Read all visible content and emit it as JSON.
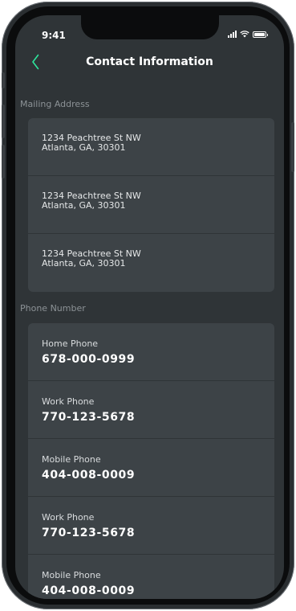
{
  "status_bar": {
    "time": "9:41"
  },
  "nav": {
    "title": "Contact Information"
  },
  "mailing": {
    "label": "Mailing Address",
    "items": [
      {
        "line1": "1234 Peachtree St NW",
        "line2": "Atlanta, GA, 30301"
      },
      {
        "line1": "1234 Peachtree St NW",
        "line2": "Atlanta, GA, 30301"
      },
      {
        "line1": "1234 Peachtree St NW",
        "line2": "Atlanta, GA, 30301"
      }
    ]
  },
  "phones": {
    "label": "Phone Number",
    "items": [
      {
        "type": "Home Phone",
        "number": "678-000-0999"
      },
      {
        "type": "Work Phone",
        "number": "770-123-5678"
      },
      {
        "type": "Mobile Phone",
        "number": "404-008-0009"
      },
      {
        "type": "Work Phone",
        "number": "770-123-5678"
      },
      {
        "type": "Mobile Phone",
        "number": "404-008-0009"
      }
    ]
  },
  "colors": {
    "accent": "#2ee59d",
    "background": "#2f3437",
    "card": "#3d4347"
  },
  "icons": {
    "back": "chevron-left-icon"
  }
}
